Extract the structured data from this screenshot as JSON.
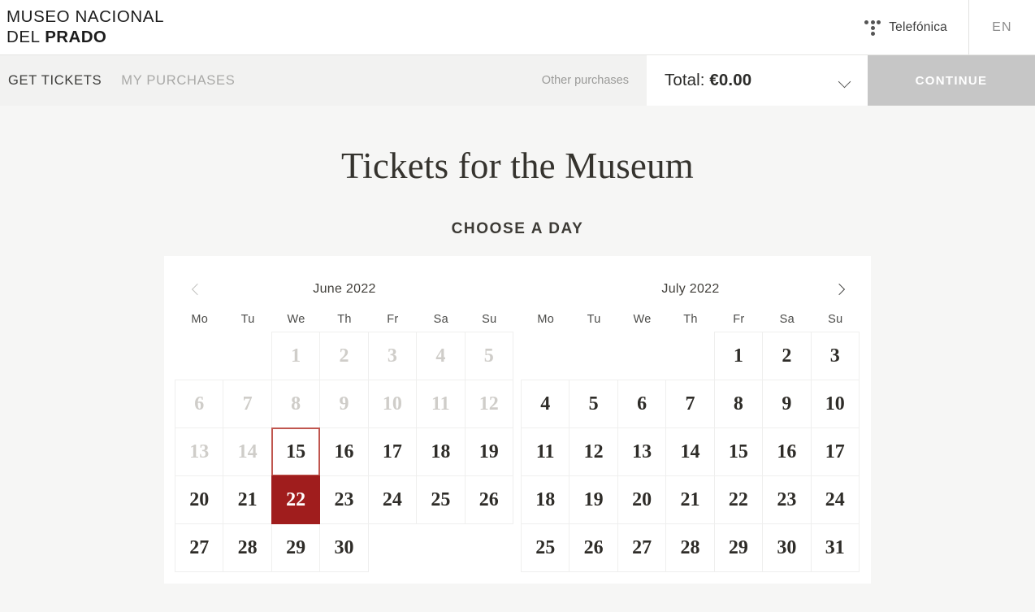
{
  "header": {
    "logo_line1": "MUSEO NACIONAL",
    "logo_line2_light": "DEL ",
    "logo_line2_bold": "PRADO",
    "sponsor_icon": "telefonica-dots-logo",
    "sponsor_name": "Telefónica",
    "language": "EN"
  },
  "navbar": {
    "links": [
      {
        "label": "GET TICKETS",
        "active": true
      },
      {
        "label": "MY PURCHASES",
        "active": false
      }
    ],
    "other_purchases_label": "Other purchases",
    "total_prefix": "Total: ",
    "total_amount": "€0.00",
    "total_chevron_icon": "chevron-down-icon",
    "continue_label": "CONTINUE"
  },
  "main": {
    "page_title": "Tickets for the Museum",
    "section_title": "CHOOSE A DAY"
  },
  "calendar": {
    "prev_icon": "chevron-left-icon",
    "next_icon": "chevron-right-icon",
    "prev_enabled": false,
    "next_enabled": true,
    "weekdays": [
      "Mo",
      "Tu",
      "We",
      "Th",
      "Fr",
      "Sa",
      "Su"
    ],
    "months": [
      {
        "name": "June 2022",
        "lead_blanks": 2,
        "days": [
          {
            "n": "1",
            "state": "disabled"
          },
          {
            "n": "2",
            "state": "disabled"
          },
          {
            "n": "3",
            "state": "disabled"
          },
          {
            "n": "4",
            "state": "disabled"
          },
          {
            "n": "5",
            "state": "disabled"
          },
          {
            "n": "6",
            "state": "disabled"
          },
          {
            "n": "7",
            "state": "disabled"
          },
          {
            "n": "8",
            "state": "disabled"
          },
          {
            "n": "9",
            "state": "disabled"
          },
          {
            "n": "10",
            "state": "disabled"
          },
          {
            "n": "11",
            "state": "disabled"
          },
          {
            "n": "12",
            "state": "disabled"
          },
          {
            "n": "13",
            "state": "disabled"
          },
          {
            "n": "14",
            "state": "disabled"
          },
          {
            "n": "15",
            "state": "today"
          },
          {
            "n": "16",
            "state": "available"
          },
          {
            "n": "17",
            "state": "available"
          },
          {
            "n": "18",
            "state": "available"
          },
          {
            "n": "19",
            "state": "available"
          },
          {
            "n": "20",
            "state": "available"
          },
          {
            "n": "21",
            "state": "available"
          },
          {
            "n": "22",
            "state": "selected"
          },
          {
            "n": "23",
            "state": "available"
          },
          {
            "n": "24",
            "state": "available"
          },
          {
            "n": "25",
            "state": "available"
          },
          {
            "n": "26",
            "state": "available"
          },
          {
            "n": "27",
            "state": "available"
          },
          {
            "n": "28",
            "state": "available"
          },
          {
            "n": "29",
            "state": "available"
          },
          {
            "n": "30",
            "state": "available"
          }
        ]
      },
      {
        "name": "July 2022",
        "lead_blanks": 4,
        "days": [
          {
            "n": "1",
            "state": "available"
          },
          {
            "n": "2",
            "state": "available"
          },
          {
            "n": "3",
            "state": "available"
          },
          {
            "n": "4",
            "state": "available"
          },
          {
            "n": "5",
            "state": "available"
          },
          {
            "n": "6",
            "state": "available"
          },
          {
            "n": "7",
            "state": "available"
          },
          {
            "n": "8",
            "state": "available"
          },
          {
            "n": "9",
            "state": "available"
          },
          {
            "n": "10",
            "state": "available"
          },
          {
            "n": "11",
            "state": "available"
          },
          {
            "n": "12",
            "state": "available"
          },
          {
            "n": "13",
            "state": "available"
          },
          {
            "n": "14",
            "state": "available"
          },
          {
            "n": "15",
            "state": "available"
          },
          {
            "n": "16",
            "state": "available"
          },
          {
            "n": "17",
            "state": "available"
          },
          {
            "n": "18",
            "state": "available"
          },
          {
            "n": "19",
            "state": "available"
          },
          {
            "n": "20",
            "state": "available"
          },
          {
            "n": "21",
            "state": "available"
          },
          {
            "n": "22",
            "state": "available"
          },
          {
            "n": "23",
            "state": "available"
          },
          {
            "n": "24",
            "state": "available"
          },
          {
            "n": "25",
            "state": "available"
          },
          {
            "n": "26",
            "state": "available"
          },
          {
            "n": "27",
            "state": "available"
          },
          {
            "n": "28",
            "state": "available"
          },
          {
            "n": "29",
            "state": "available"
          },
          {
            "n": "30",
            "state": "available"
          },
          {
            "n": "31",
            "state": "available"
          }
        ]
      }
    ]
  },
  "colors": {
    "selected_day": "#a01d1d",
    "today_outline": "#c0564f",
    "page_background": "#f6f6f5",
    "navbar_background": "#f2f2f1",
    "continue_button": "#c6c6c6"
  }
}
